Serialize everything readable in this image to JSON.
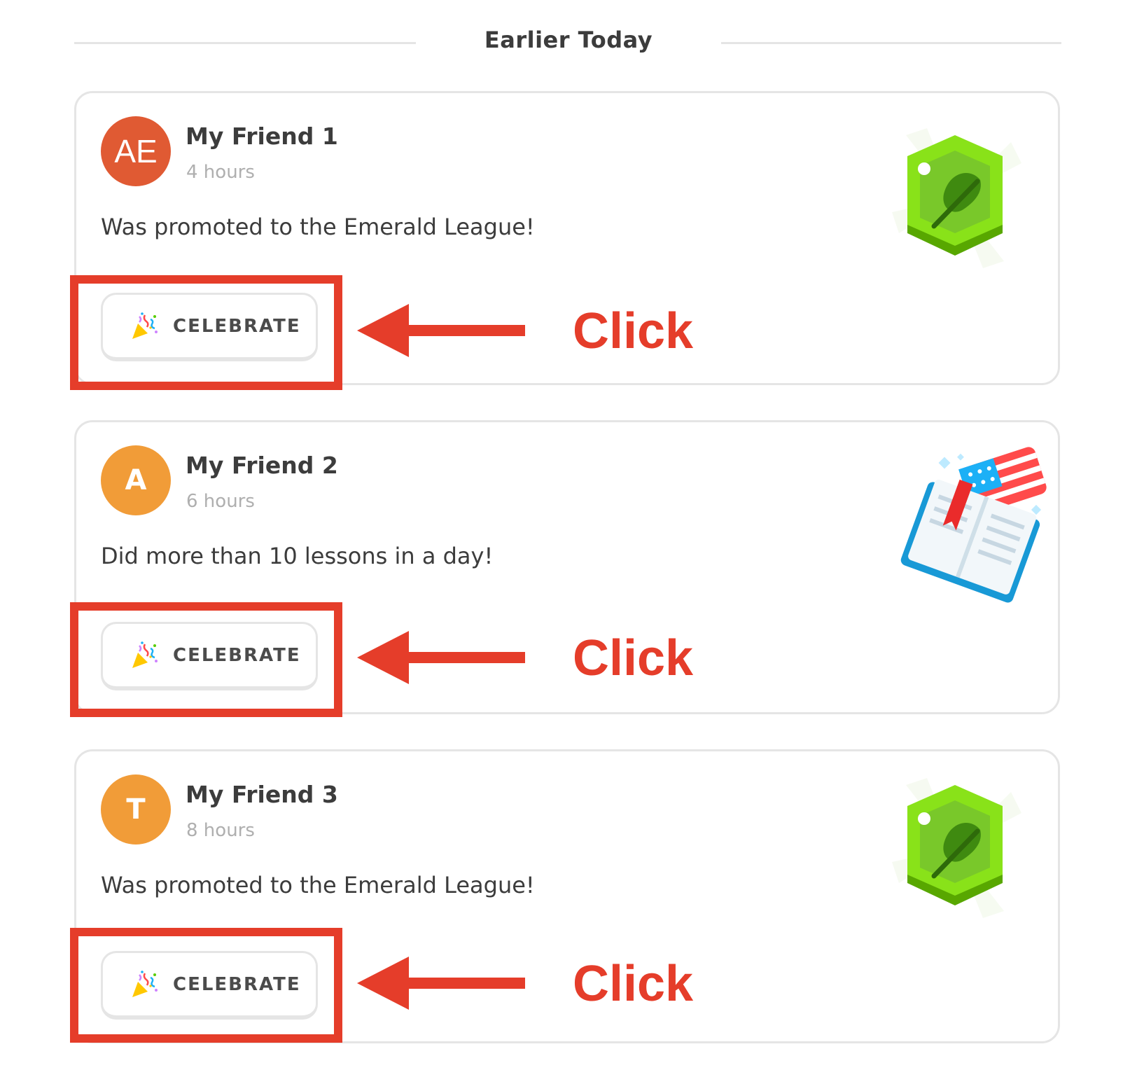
{
  "section": {
    "title": "Earlier Today"
  },
  "feed": [
    {
      "name": "My Friend 1",
      "time": "4 hours",
      "message": "Was promoted to the Emerald League!",
      "avatar": {
        "initials": "AE",
        "color": "#e05a33"
      },
      "button_label": "CELEBRATE",
      "art": "emerald-league-badge"
    },
    {
      "name": "My Friend 2",
      "time": "6 hours",
      "message": "Did more than 10 lessons in a day!",
      "avatar": {
        "initials": "A",
        "color": "#f19c38"
      },
      "button_label": "CELEBRATE",
      "art": "book-with-us-flag"
    },
    {
      "name": "My Friend 3",
      "time": "8 hours",
      "message": "Was promoted to the Emerald League!",
      "avatar": {
        "initials": "T",
        "color": "#f19c38"
      },
      "button_label": "CELEBRATE",
      "art": "emerald-league-badge"
    }
  ],
  "annotations": {
    "click_label": "Click",
    "color": "#e53d2a"
  }
}
